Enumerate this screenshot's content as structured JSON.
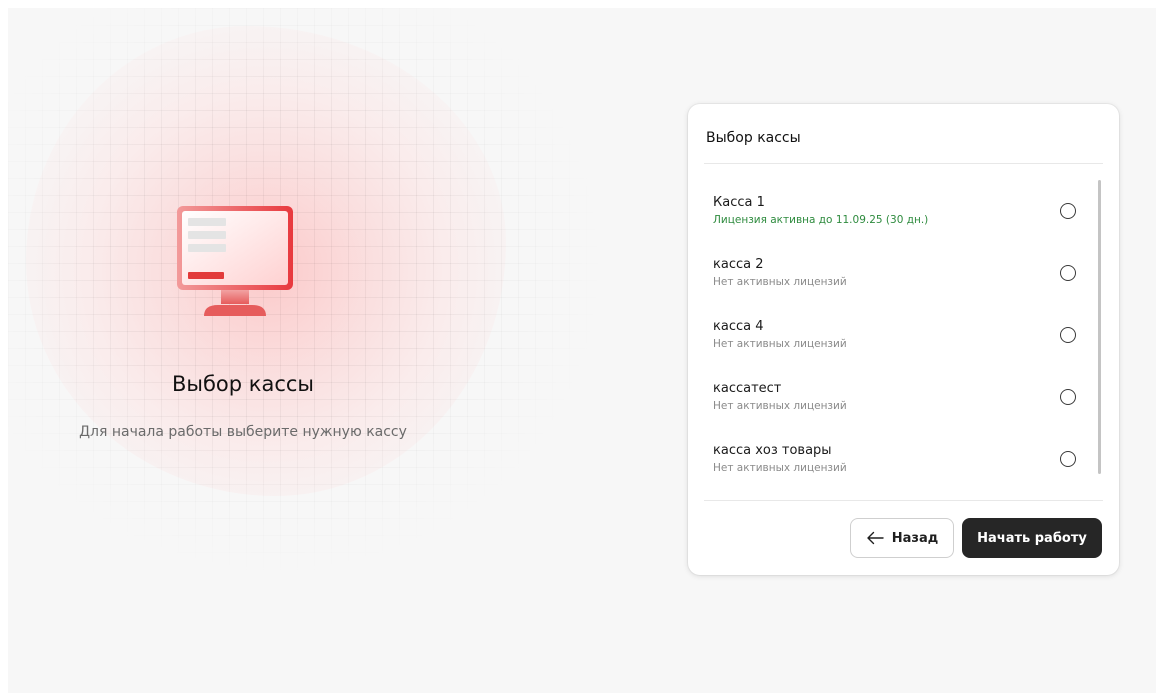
{
  "hero": {
    "title": "Выбор кассы",
    "subtitle": "Для начала работы выберите нужную кассу",
    "illustration_icon": "monitor-icon"
  },
  "card": {
    "title": "Выбор кассы",
    "items": [
      {
        "name": "Касса 1",
        "status": "Лицензия активна до 11.09.25 (30 дн.)",
        "status_type": "active",
        "selected": false
      },
      {
        "name": "касса 2",
        "status": "Нет активных лицензий",
        "status_type": "none",
        "selected": false
      },
      {
        "name": "касса 4",
        "status": "Нет активных лицензий",
        "status_type": "none",
        "selected": false
      },
      {
        "name": "кассатест",
        "status": "Нет активных лицензий",
        "status_type": "none",
        "selected": false
      },
      {
        "name": "касса хоз товары",
        "status": "Нет активных лицензий",
        "status_type": "none",
        "selected": false
      }
    ],
    "back_label": "Назад",
    "start_label": "Начать работу",
    "back_icon": "arrow-left-icon"
  },
  "colors": {
    "accent": "#e0393e",
    "active_status": "#2e8b3e",
    "primary_button": "#262626"
  }
}
